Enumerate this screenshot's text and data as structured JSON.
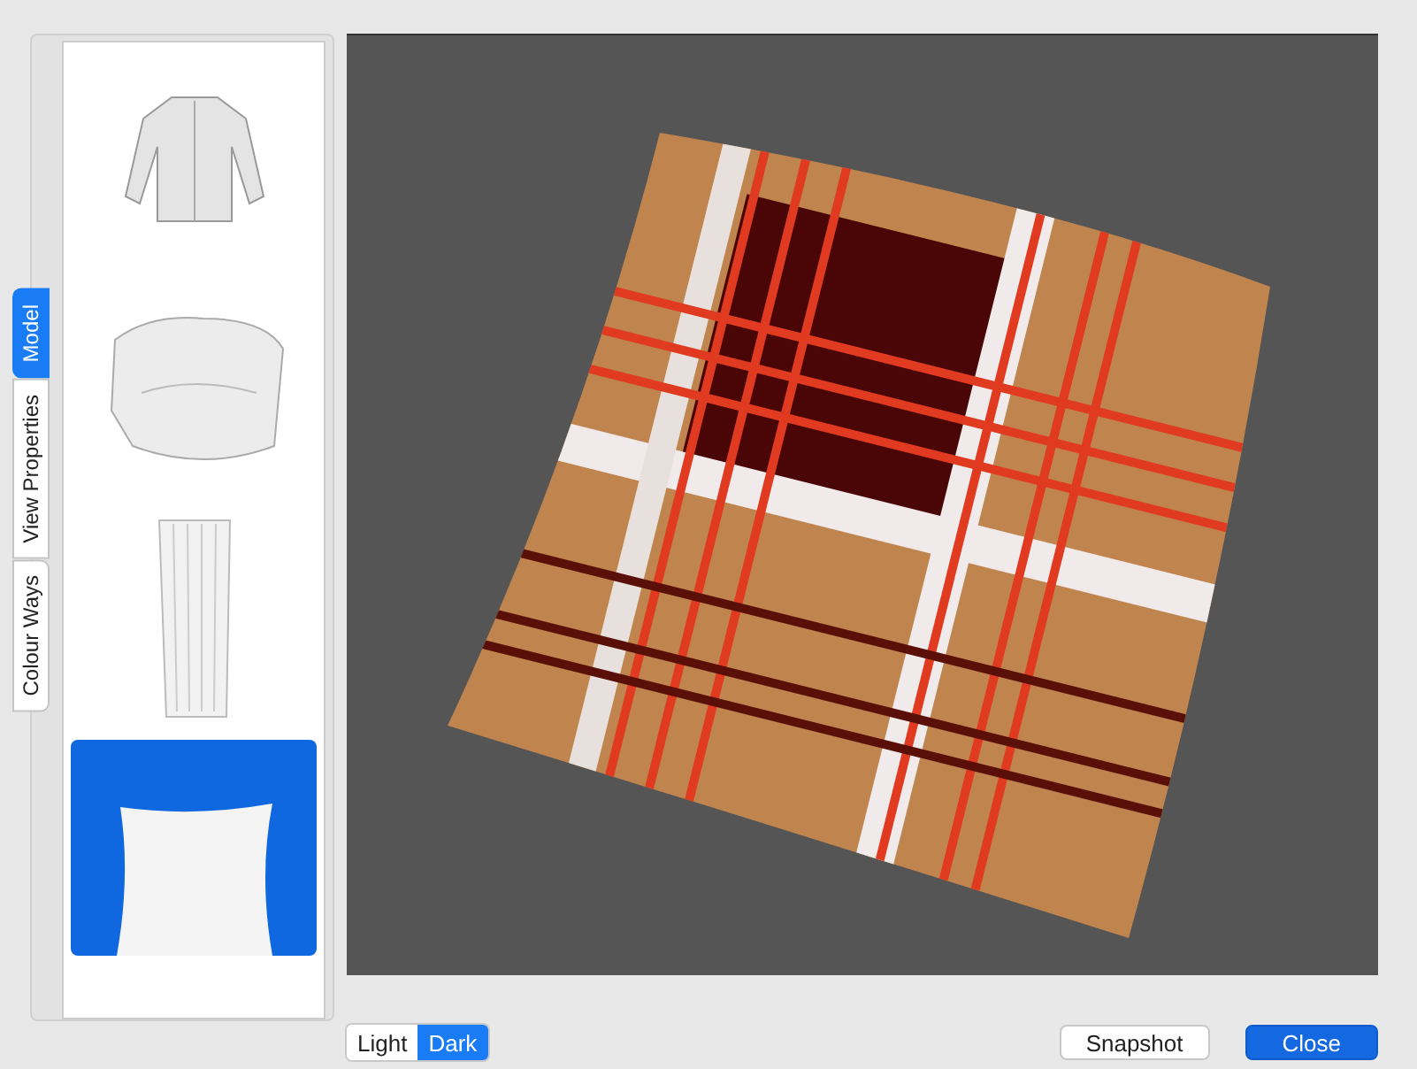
{
  "side_tabs": [
    {
      "label": "Model",
      "selected": true
    },
    {
      "label": "View Properties",
      "selected": false
    },
    {
      "label": "Colour Ways",
      "selected": false
    }
  ],
  "models": [
    {
      "kind": "jacket",
      "selected": false
    },
    {
      "kind": "armchair",
      "selected": false
    },
    {
      "kind": "curtain",
      "selected": false
    },
    {
      "kind": "pillow",
      "selected": true
    }
  ],
  "background_toggle": [
    {
      "label": "Light",
      "selected": false
    },
    {
      "label": "Dark",
      "selected": true
    }
  ],
  "buttons": [
    {
      "label": "Snapshot",
      "kind": "normal"
    },
    {
      "label": "Close",
      "kind": "default"
    }
  ]
}
